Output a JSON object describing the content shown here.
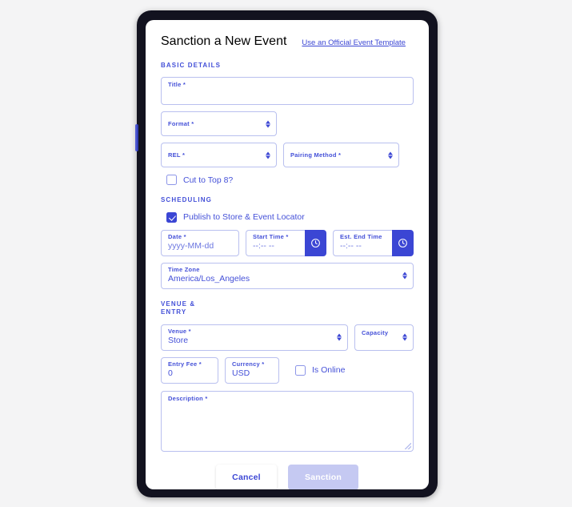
{
  "colors": {
    "accent": "#3b46d4",
    "field_border": "#b9c0ef",
    "bezel": "#12121f",
    "page_background": "#f4f4f5",
    "disabled_button": "#c5c9f2"
  },
  "header": {
    "title": "Sanction a New Event",
    "template_link": "Use an Official Event Template"
  },
  "sections": {
    "basic_details": {
      "heading": "BASIC DETAILS",
      "title_field": {
        "label": "Title *",
        "value": ""
      },
      "format_field": {
        "label": "Format *",
        "value": ""
      },
      "rel_field": {
        "label": "REL *",
        "value": ""
      },
      "pairing_method_field": {
        "label": "Pairing Method *",
        "value": ""
      },
      "cut_checkbox": {
        "label": "Cut to Top 8?",
        "checked": false
      }
    },
    "scheduling": {
      "heading": "SCHEDULING",
      "publish_checkbox": {
        "label": "Publish to Store & Event Locator",
        "checked": true
      },
      "date_field": {
        "label": "Date *",
        "placeholder": "yyyy-MM-dd"
      },
      "start_time_field": {
        "label": "Start Time *",
        "placeholder": "--:-- --"
      },
      "end_time_field": {
        "label": "Est. End Time",
        "placeholder": "--:-- --"
      },
      "timezone_field": {
        "label": "Time Zone",
        "value": "America/Los_Angeles"
      }
    },
    "venue_entry": {
      "heading": "VENUE & ENTRY",
      "venue_field": {
        "label": "Venue *",
        "value": "Store"
      },
      "capacity_field": {
        "label": "Capacity",
        "value": ""
      },
      "entry_fee_field": {
        "label": "Entry Fee *",
        "value": "0"
      },
      "currency_field": {
        "label": "Currency *",
        "value": "USD"
      },
      "is_online_checkbox": {
        "label": "Is Online",
        "checked": false
      },
      "description_field": {
        "label": "Description *",
        "value": ""
      }
    }
  },
  "footer": {
    "cancel_label": "Cancel",
    "sanction_label": "Sanction"
  },
  "icons": {
    "clock": "clock-icon",
    "spinner": "spinner-arrows-icon",
    "resize": "resize-handle-icon"
  }
}
